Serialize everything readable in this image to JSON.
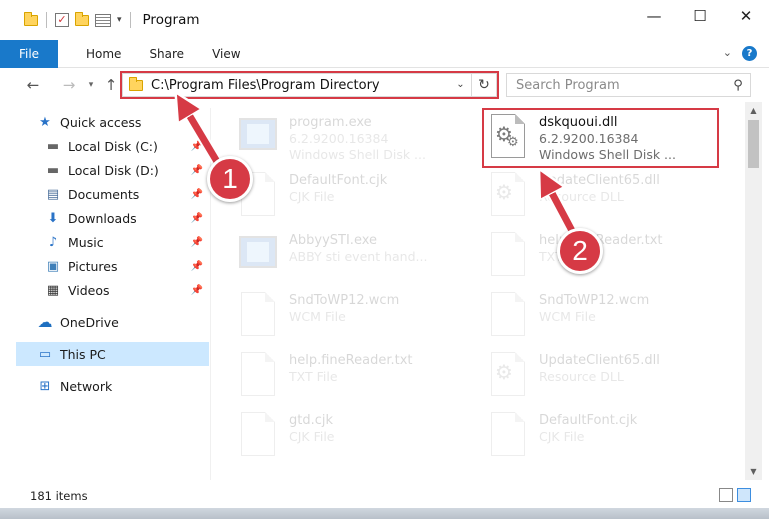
{
  "window": {
    "title": "Program",
    "minimize": "—",
    "maximize": "☐",
    "close": "✕",
    "qat_check": "✓",
    "qat_arrow": "▾"
  },
  "ribbon": {
    "file_tab": "File",
    "tabs": [
      "Home",
      "Share",
      "View"
    ],
    "collapse": "⌄",
    "help": "?"
  },
  "nav": {
    "back": "←",
    "forward": "→",
    "recent": "▾",
    "up": "↑",
    "address": "C:\\Program Files\\Program Directory",
    "address_dropdown": "⌄",
    "refresh": "↻",
    "search_placeholder": "Search Program",
    "search_icon": "⚲"
  },
  "sidebar": {
    "items": [
      {
        "label": "Quick access",
        "icon": "★",
        "pinned": false
      },
      {
        "label": "Local Disk (C:)",
        "icon": "▬",
        "pinned": true
      },
      {
        "label": "Local Disk (D:)",
        "icon": "▬",
        "pinned": true
      },
      {
        "label": "Documents",
        "icon": "▤",
        "pinned": true
      },
      {
        "label": "Downloads",
        "icon": "⬇",
        "pinned": true
      },
      {
        "label": "Music",
        "icon": "♪",
        "pinned": true
      },
      {
        "label": "Pictures",
        "icon": "▣",
        "pinned": true
      },
      {
        "label": "Videos",
        "icon": "▦",
        "pinned": true
      },
      {
        "label": "OneDrive",
        "icon": "☁",
        "pinned": false
      },
      {
        "label": "This PC",
        "icon": "▭",
        "pinned": false
      },
      {
        "label": "Network",
        "icon": "⊞",
        "pinned": false
      }
    ],
    "pin_icon": "📌",
    "selected": "This PC"
  },
  "files": [
    {
      "name": "program.exe",
      "line2": "6.2.9200.16384",
      "line3": "Windows Shell Disk ...",
      "icon": "app",
      "faded": true
    },
    {
      "name": "dskquoui.dll",
      "line2": "6.2.9200.16384",
      "line3": "Windows Shell Disk ...",
      "icon": "gear",
      "faded": false,
      "highlighted": true
    },
    {
      "name": "DefaultFont.cjk",
      "line2": "CJK File",
      "line3": "",
      "icon": "doc",
      "faded": true
    },
    {
      "name": "UpdateClient65.dll",
      "line2": "Resource DLL",
      "line3": "",
      "icon": "gear",
      "faded": true
    },
    {
      "name": "AbbyySTI.exe",
      "line2": "ABBY sti event hand...",
      "line3": "",
      "icon": "app",
      "faded": true
    },
    {
      "name": "help.fineReader.txt",
      "line2": "TXT File",
      "line3": "",
      "icon": "doc",
      "faded": true
    },
    {
      "name": "SndToWP12.wcm",
      "line2": "WCM File",
      "line3": "",
      "icon": "doc",
      "faded": true
    },
    {
      "name": "SndToWP12.wcm",
      "line2": "WCM File",
      "line3": "",
      "icon": "doc",
      "faded": true
    },
    {
      "name": "help.fineReader.txt",
      "line2": "TXT File",
      "line3": "",
      "icon": "doc",
      "faded": true
    },
    {
      "name": "UpdateClient65.dll",
      "line2": "Resource DLL",
      "line3": "",
      "icon": "gear",
      "faded": true
    },
    {
      "name": "gtd.cjk",
      "line2": "CJK File",
      "line3": "",
      "icon": "doc",
      "faded": true
    },
    {
      "name": "DefaultFont.cjk",
      "line2": "CJK File",
      "line3": "",
      "icon": "doc",
      "faded": true
    }
  ],
  "gear_glyph": "⚙",
  "status": {
    "items_count": "181 items"
  },
  "annotations": {
    "badge_1": "1",
    "badge_2": "2",
    "color": "#d63a45"
  }
}
